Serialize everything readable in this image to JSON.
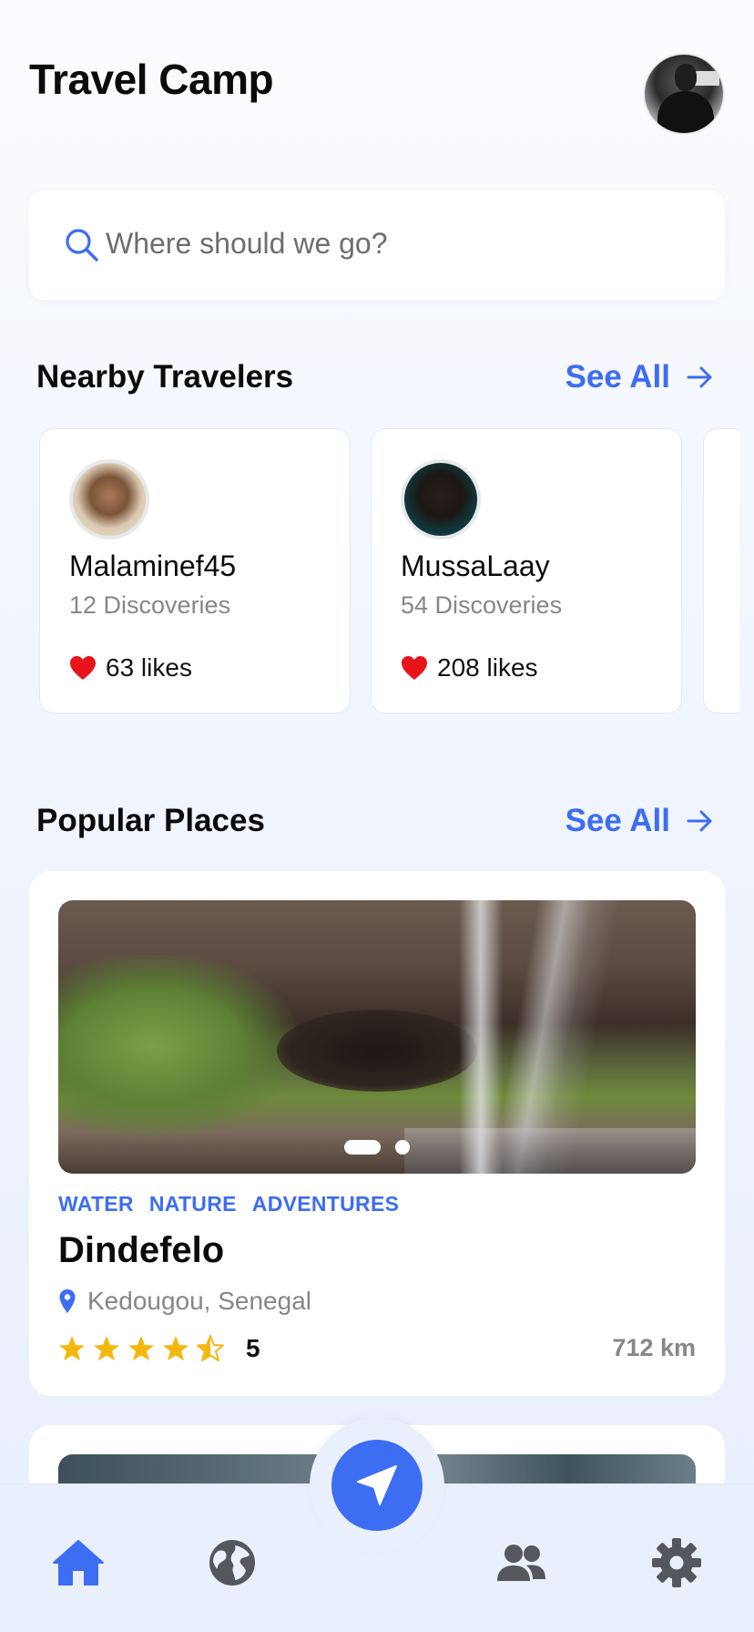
{
  "header": {
    "title": "Travel Camp"
  },
  "search": {
    "placeholder": "Where should we go?"
  },
  "nearby": {
    "title": "Nearby Travelers",
    "see_all": "See All",
    "travelers": [
      {
        "name": "Malaminef45",
        "discoveries": "12 Discoveries",
        "likes": "63 likes"
      },
      {
        "name": "MussaLaay",
        "discoveries": "54 Discoveries",
        "likes": "208 likes"
      }
    ]
  },
  "popular": {
    "title": "Popular Places",
    "see_all": "See All",
    "places": [
      {
        "tags": [
          "WATER",
          "NATURE",
          "ADVENTURES"
        ],
        "name": "Dindefelo",
        "location": "Kedougou, Senegal",
        "rating": "5",
        "stars": 4.5,
        "distance": "712 km",
        "carousel": {
          "count": 2,
          "active": 0
        }
      }
    ]
  },
  "tabbar": {
    "tabs": [
      {
        "icon": "home-icon",
        "active": true
      },
      {
        "icon": "globe-icon",
        "active": false
      },
      {
        "icon": "navigation-icon",
        "active": false
      },
      {
        "icon": "users-icon",
        "active": false
      },
      {
        "icon": "gear-icon",
        "active": false
      }
    ]
  },
  "colors": {
    "accent": "#3d6df2",
    "heart": "#e8141b",
    "star": "#f6b70f",
    "muted": "#86868b"
  }
}
